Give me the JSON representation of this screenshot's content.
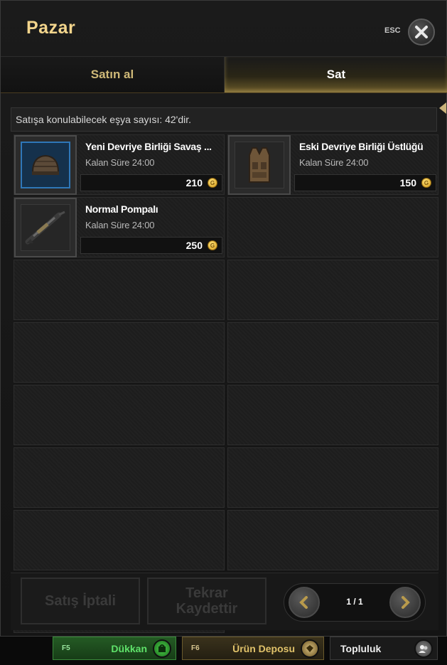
{
  "header": {
    "title": "Pazar",
    "esc_label": "ESC"
  },
  "tabs": [
    {
      "label": "Satın al"
    },
    {
      "label": "Sat"
    }
  ],
  "info": {
    "count_text": "Satışa konulabilecek eşya sayısı: 42'dir."
  },
  "items": [
    {
      "name": "Yeni Devriye Birliği Savaş ...",
      "time": "Kalan Süre  24:00",
      "price": "210",
      "icon": "helmet-icon",
      "coin_symbol": "G"
    },
    {
      "name": "Eski Devriye Birliği Üstlüğü",
      "time": "Kalan Süre  24:00",
      "price": "150",
      "icon": "vest-icon",
      "coin_symbol": "G"
    },
    {
      "name": "Normal Pompalı",
      "time": "Kalan Süre  24:00",
      "price": "250",
      "icon": "shotgun-icon",
      "coin_symbol": "G"
    }
  ],
  "bottom": {
    "cancel_label": "Satış İptali",
    "reregister_label_line1": "Tekrar",
    "reregister_label_line2": "Kaydettir",
    "page": "1 / 1"
  },
  "taskbar": {
    "shop": {
      "key": "F5",
      "label": "Dükkan"
    },
    "storage": {
      "key": "F6",
      "label": "Ürün Deposu"
    },
    "community": {
      "label": "Topluluk"
    }
  },
  "colors": {
    "title": "#f3d58c",
    "shop_green": "#3cc24a",
    "storage_gold": "#e0c26a",
    "selected_blue": "#2f77b8"
  }
}
